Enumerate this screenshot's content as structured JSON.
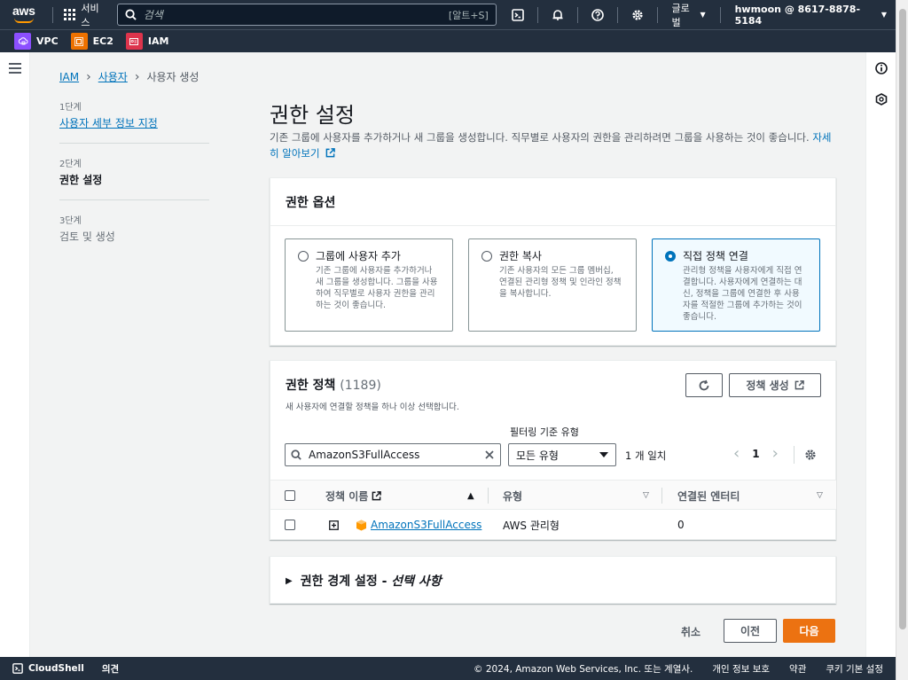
{
  "topnav": {
    "logo_text": "aws",
    "services_label": "서비스",
    "search_placeholder": "검색",
    "search_shortcut": "[알트+S]",
    "region_label": "글로벌",
    "account_label": "hwmoon @ 8617-8878-5184"
  },
  "favorites": [
    {
      "label": "VPC",
      "color": "#8c4fff"
    },
    {
      "label": "EC2",
      "color": "#ed7100"
    },
    {
      "label": "IAM",
      "color": "#dd344c"
    }
  ],
  "breadcrumb": {
    "item1": "IAM",
    "item2": "사용자",
    "item3": "사용자 생성"
  },
  "steps": [
    {
      "num": "1단계",
      "label": "사용자 세부 정보 지정"
    },
    {
      "num": "2단계",
      "label": "권한 설정"
    },
    {
      "num": "3단계",
      "label": "검토 및 생성"
    }
  ],
  "page": {
    "title": "권한 설정",
    "desc": "기존 그룹에 사용자를 추가하거나 새 그룹을 생성합니다. 직무별로 사용자의 권한을 관리하려면 그룹을 사용하는 것이 좋습니다.",
    "learn_more": "자세히 알아보기"
  },
  "options_panel": {
    "title": "권한 옵션",
    "options": [
      {
        "label": "그룹에 사용자 추가",
        "desc": "기존 그룹에 사용자를 추가하거나 새 그룹을 생성합니다. 그룹을 사용하여 직무별로 사용자 권한을 관리하는 것이 좋습니다.",
        "selected": false
      },
      {
        "label": "권한 복사",
        "desc": "기존 사용자의 모든 그룹 멤버십, 연결된 관리형 정책 및 인라인 정책을 복사합니다.",
        "selected": false
      },
      {
        "label": "직접 정책 연결",
        "desc": "관리형 정책을 사용자에게 직접 연결합니다. 사용자에게 연결하는 대신, 정책을 그룹에 연결한 후 사용자를 적절한 그룹에 추가하는 것이 좋습니다.",
        "selected": true
      }
    ]
  },
  "policies_panel": {
    "title": "권한 정책",
    "count": "(1189)",
    "subtitle": "새 사용자에 연결할 정책을 하나 이상 선택합니다.",
    "create_policy": "정책 생성",
    "filter_type_label": "필터링 기준 유형",
    "search_value": "AmazonS3FullAccess",
    "type_select": "모든 유형",
    "match_text": "1 개 일치",
    "page_number": "1",
    "columns": {
      "name": "정책 이름",
      "type": "유형",
      "entities": "연결된 엔터티"
    },
    "rows": [
      {
        "name": "AmazonS3FullAccess",
        "type": "AWS 관리형",
        "entities": "0"
      }
    ]
  },
  "boundary_panel": {
    "title": "권한 경계 설정 - ",
    "optional": "선택 사항"
  },
  "actions": {
    "cancel": "취소",
    "prev": "이전",
    "next": "다음"
  },
  "footer": {
    "cloudshell": "CloudShell",
    "feedback": "의견",
    "copyright": "© 2024, Amazon Web Services, Inc. 또는 계열사.",
    "privacy": "개인 정보 보호",
    "terms": "약관",
    "cookies": "쿠키 기본 설정"
  }
}
